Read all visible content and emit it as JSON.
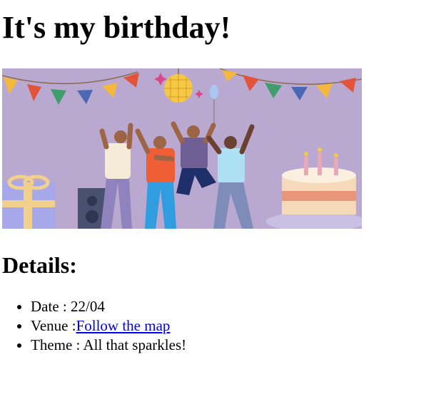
{
  "page": {
    "title": "It's my birthday!"
  },
  "banner": {
    "alt": "Birthday party illustration"
  },
  "details": {
    "heading": "Details:",
    "items": [
      {
        "label": "Date : ",
        "value": "22/04"
      },
      {
        "label": "Venue :",
        "link_text": "Follow the map"
      },
      {
        "label": "Theme : ",
        "value": "All that sparkles!"
      }
    ]
  },
  "colors": {
    "background": "#ffffff",
    "text": "#000000",
    "link": "#0000ee",
    "banner_bg": "#b9a9d1"
  }
}
